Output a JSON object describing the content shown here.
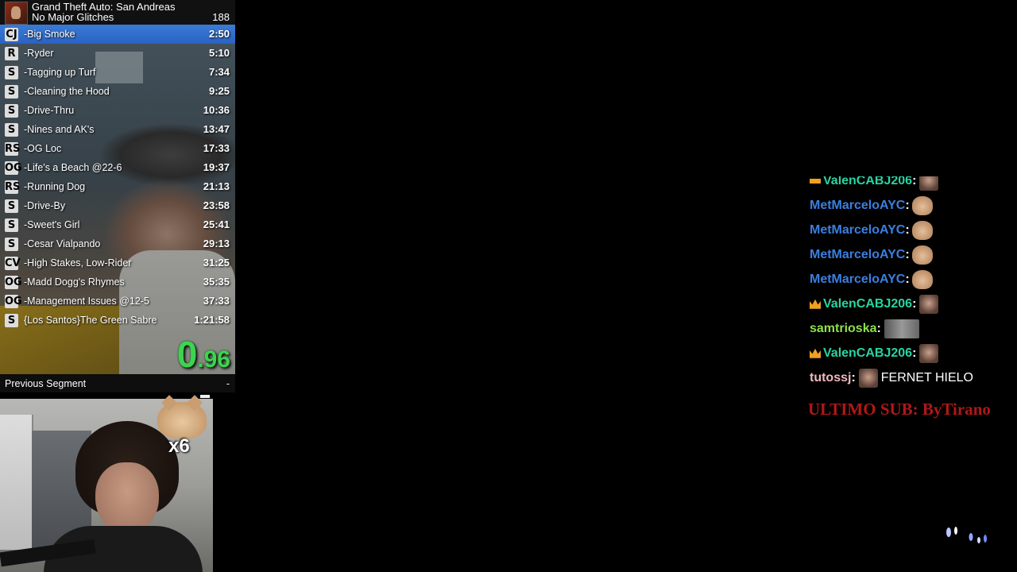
{
  "header": {
    "game_title": "Grand Theft Auto: San Andreas",
    "category": "No Major Glitches",
    "attempt_count": "188"
  },
  "splits": [
    {
      "icon": "CJ",
      "name": "-Big Smoke",
      "time": "2:50",
      "current": true
    },
    {
      "icon": "R",
      "name": "-Ryder",
      "time": "5:10",
      "current": false
    },
    {
      "icon": "S",
      "name": "-Tagging up Turf",
      "time": "7:34",
      "current": false
    },
    {
      "icon": "S",
      "name": "-Cleaning the Hood",
      "time": "9:25",
      "current": false
    },
    {
      "icon": "S",
      "name": "-Drive-Thru",
      "time": "10:36",
      "current": false
    },
    {
      "icon": "S",
      "name": "-Nines and AK's",
      "time": "13:47",
      "current": false
    },
    {
      "icon": "RS",
      "name": "-OG Loc",
      "time": "17:33",
      "current": false
    },
    {
      "icon": "OG",
      "name": "-Life's a Beach @22-6",
      "time": "19:37",
      "current": false
    },
    {
      "icon": "RS",
      "name": "-Running Dog",
      "time": "21:13",
      "current": false
    },
    {
      "icon": "S",
      "name": "-Drive-By",
      "time": "23:58",
      "current": false
    },
    {
      "icon": "S",
      "name": "-Sweet's Girl",
      "time": "25:41",
      "current": false
    },
    {
      "icon": "S",
      "name": "-Cesar Vialpando",
      "time": "29:13",
      "current": false
    },
    {
      "icon": "CV",
      "name": "-High Stakes, Low-Rider",
      "time": "31:25",
      "current": false
    },
    {
      "icon": "OG",
      "name": "-Madd Dogg's Rhymes",
      "time": "35:35",
      "current": false
    },
    {
      "icon": "OG",
      "name": "-Management Issues @12-5",
      "time": "37:33",
      "current": false
    },
    {
      "icon": "S",
      "name": "{Los Santos}The Green Sabre",
      "time": "1:21:58",
      "current": false
    }
  ],
  "timer": {
    "whole": "0",
    "fraction": ".96",
    "color": "#3dd44f"
  },
  "previous_segment": {
    "label": "Previous Segment",
    "value": "-"
  },
  "webcam": {
    "emote_count": "x6"
  },
  "chat": [
    {
      "user": "ValenCABJ206",
      "user_color": "#2ad4a0",
      "badge": "crown-icon",
      "text": ""
    },
    {
      "user": "MetMarceloAYC",
      "user_color": "#3a7fe0",
      "badge": "",
      "text": ""
    },
    {
      "user": "MetMarceloAYC",
      "user_color": "#3a7fe0",
      "badge": "",
      "text": ""
    },
    {
      "user": "MetMarceloAYC",
      "user_color": "#3a7fe0",
      "badge": "",
      "text": ""
    },
    {
      "user": "MetMarceloAYC",
      "user_color": "#3a7fe0",
      "badge": "",
      "text": ""
    },
    {
      "user": "ValenCABJ206",
      "user_color": "#2ad4a0",
      "badge": "crown-icon",
      "text": ""
    },
    {
      "user": "samtrioska",
      "user_color": "#8ee04a",
      "badge": "",
      "text": ""
    },
    {
      "user": "ValenCABJ206",
      "user_color": "#2ad4a0",
      "badge": "crown-icon",
      "text": ""
    },
    {
      "user": "tutossj",
      "user_color": "#f0b8c0",
      "badge": "",
      "text": "FERNET HIELO"
    }
  ],
  "last_sub": "ULTIMO SUB: ByTirano",
  "colors": {
    "current_split": "#2a62c4",
    "sub_text": "#b01818",
    "background": "#000000"
  }
}
